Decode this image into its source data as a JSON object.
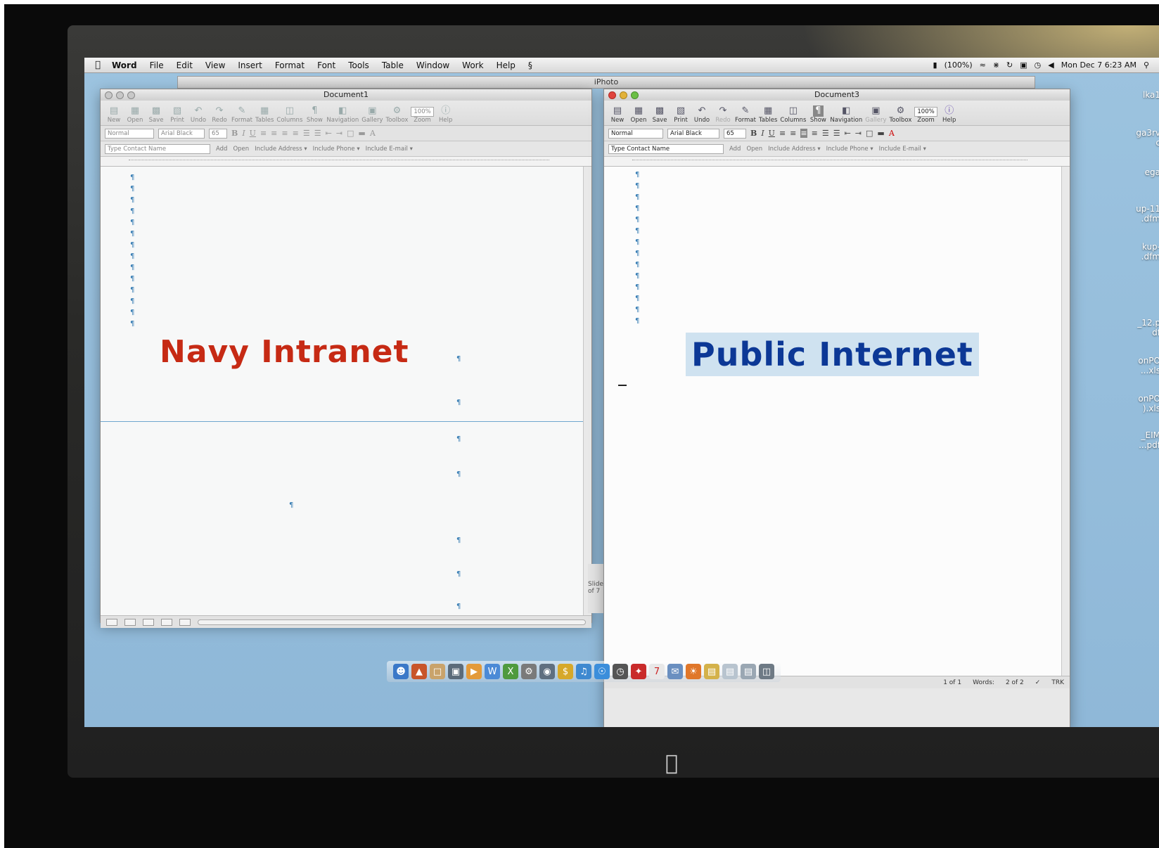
{
  "menubar": {
    "apple_icon": "apple-icon",
    "items": [
      "Word",
      "File",
      "Edit",
      "View",
      "Insert",
      "Format",
      "Font",
      "Tools",
      "Table",
      "Window",
      "Work",
      "Help"
    ],
    "battery": "(100%)",
    "clock": "Mon Dec 7  6:23 AM"
  },
  "iphoto": {
    "title": "iPhoto"
  },
  "window1": {
    "title": "Document1",
    "toolbar": [
      "New",
      "Open",
      "Save",
      "Print",
      "Undo",
      "Redo",
      "Format",
      "Tables",
      "Columns",
      "Show",
      "Navigation",
      "Gallery",
      "Toolbox",
      "Zoom",
      "Help"
    ],
    "zoom": "100%",
    "style": "Normal",
    "font": "Arial Black",
    "size": "65",
    "contact_placeholder": "Type Contact Name",
    "contact_actions": [
      "Add",
      "Open",
      "Include Address ▾",
      "Include Phone ▾",
      "Include E-mail ▾"
    ],
    "headline": "Navy Intranet",
    "headline_color": "#c62a14"
  },
  "window2": {
    "title": "Document3",
    "toolbar": [
      "New",
      "Open",
      "Save",
      "Print",
      "Undo",
      "Redo",
      "Format",
      "Tables",
      "Columns",
      "Show",
      "Navigation",
      "Gallery",
      "Toolbox",
      "Zoom",
      "Help"
    ],
    "zoom": "100%",
    "style": "Normal",
    "font": "Arial Black",
    "size": "65",
    "contact_placeholder": "Type Contact Name",
    "contact_actions": [
      "Add",
      "Open",
      "Include Address ▾",
      "Include Phone ▾",
      "Include E-mail ▾"
    ],
    "headline": "Public Internet",
    "headline_color": "#0c3896",
    "status": {
      "page": "1 of 1",
      "words_label": "Words:",
      "words": "2 of 2",
      "trk": "TRK"
    }
  },
  "desktop_labels": [
    "lka1",
    "ga3rv",
    "c",
    "ega",
    "up-11",
    ".dfm",
    "kup-",
    ".dfm",
    "_12.p",
    "df",
    "onPO",
    "...xls",
    "onPO",
    ").xls",
    "_EIM",
    "...pdf"
  ],
  "side_panel": {
    "slide_label": "Slide",
    "page_frag": "of 7"
  }
}
